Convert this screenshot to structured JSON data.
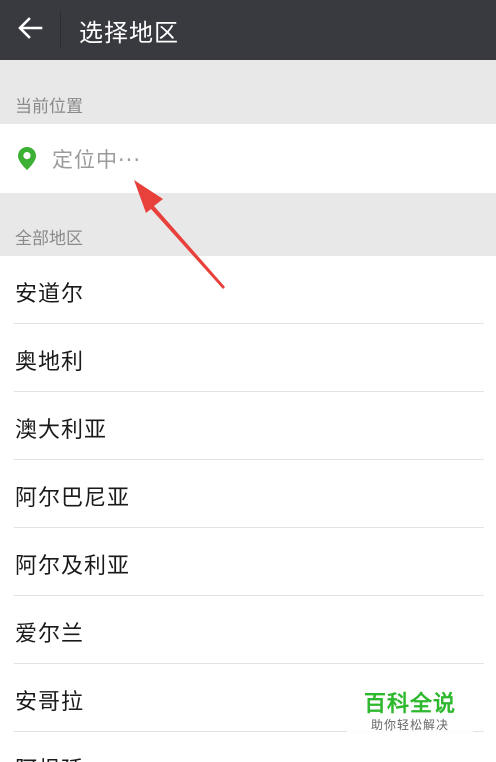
{
  "header": {
    "title": "选择地区",
    "back_icon": "arrow-left-icon"
  },
  "current_location": {
    "section_label": "当前位置",
    "status_text": "定位中···",
    "pin_icon": "location-pin-icon",
    "pin_color": "#3cb034"
  },
  "all_regions": {
    "section_label": "全部地区",
    "items": [
      {
        "label": "安道尔"
      },
      {
        "label": "奥地利"
      },
      {
        "label": "澳大利亚"
      },
      {
        "label": "阿尔巴尼亚"
      },
      {
        "label": "阿尔及利亚"
      },
      {
        "label": "爱尔兰"
      },
      {
        "label": "安哥拉"
      },
      {
        "label": "阿根廷"
      }
    ]
  },
  "watermark": {
    "brand": "百科全说",
    "tagline": "助你轻松解决",
    "color": "#2eb82e"
  },
  "annotation": {
    "arrow_color": "#e8413c"
  }
}
